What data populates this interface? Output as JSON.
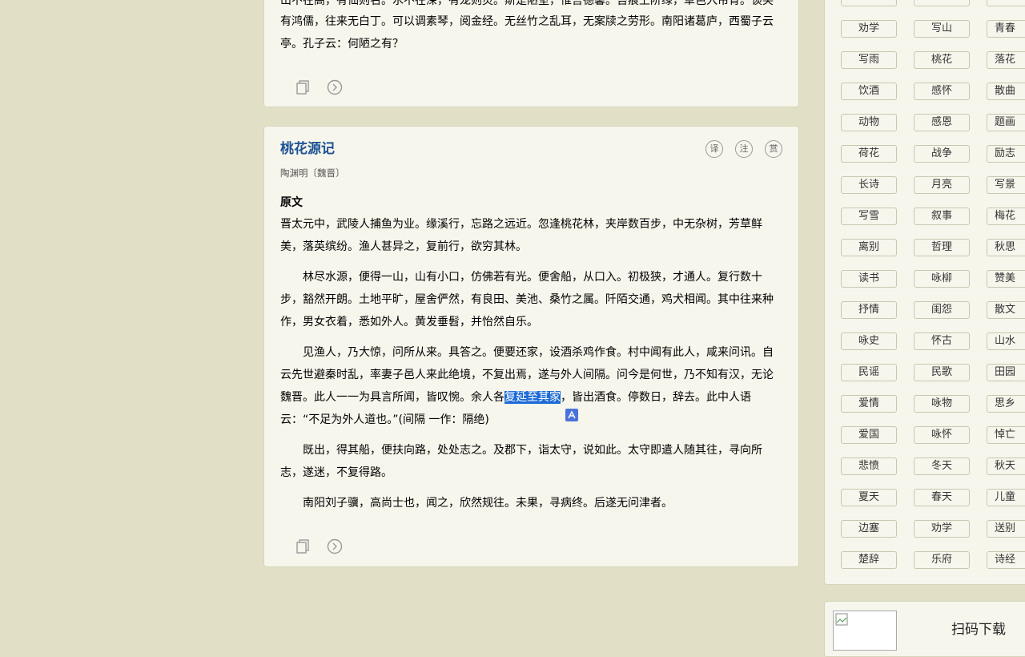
{
  "card1": {
    "top_partial": "山不在高，有仙则名。水不在深，有龙则灵。斯是陋室，惟吾德馨。苔痕上阶绿，草色入帘青。谈笑",
    "lines": [
      "有鸿儒，往来无白丁。可以调素琴，阅金经。无丝竹之乱耳，无案牍之劳形。南阳诸葛庐，西蜀子云",
      "亭。孔子云：何陋之有？"
    ]
  },
  "card2": {
    "title": "桃花源记",
    "author": "陶渊明〔魏晋〕",
    "buttons": {
      "translate": "译",
      "annotate": "注",
      "appreciate": "赏"
    },
    "section_label": "原文",
    "paragraphs": {
      "p1": "晋太元中，武陵人捕鱼为业。缘溪行，忘路之远近。忽逢桃花林，夹岸数百步，中无杂树，芳草鲜美，落英缤纷。渔人甚异之，复前行，欲穷其林。",
      "p2": "林尽水源，便得一山，山有小口，仿佛若有光。便舍船，从口入。初极狭，才通人。复行数十步，豁然开朗。土地平旷，屋舍俨然，有良田、美池、桑竹之属。阡陌交通，鸡犬相闻。其中往来种作，男女衣着，悉如外人。黄发垂髫，并怡然自乐。",
      "p3_before": "见渔人，乃大惊，问所从来。具答之。便要还家，设酒杀鸡作食。村中闻有此人，咸来问讯。自云先世避秦时乱，率妻子邑人来此绝境，不复出焉，遂与外人间隔。问今是何世，乃不知有汉，无论魏晋。此人一一为具言所闻，皆叹惋。余人各",
      "p3_highlight": "复延至其家",
      "p3_after": "，皆出酒食。停数日，辞去。此中人语云：“不足为外人道也。”(间隔 一作：隔绝)",
      "p4": "既出，得其船，便扶向路，处处志之。及郡下，诣太守，说如此。太守即遣人随其往，寻向所志，遂迷，不复得路。",
      "p5": "南阳刘子骥，高尚士也，闻之，欣然规往。未果，寻病终。后遂无问津者。"
    }
  },
  "tags": {
    "col1": [
      "劝学",
      "写雨",
      "饮酒",
      "动物",
      "荷花",
      "长诗",
      "写雪",
      "离别",
      "读书",
      "抒情",
      "咏史",
      "民谣",
      "爱情",
      "爱国",
      "悲愤",
      "夏天",
      "边塞",
      "楚辞"
    ],
    "col2": [
      "写山",
      "桃花",
      "感怀",
      "感恩",
      "战争",
      "月亮",
      "叙事",
      "哲理",
      "咏柳",
      "闺怨",
      "怀古",
      "民歌",
      "咏物",
      "咏怀",
      "冬天",
      "春天",
      "劝学",
      "乐府"
    ],
    "col3": [
      "青春",
      "落花",
      "散曲",
      "题画",
      "励志",
      "写景",
      "梅花",
      "秋思",
      "赞美",
      "散文",
      "山水",
      "田园",
      "思乡",
      "悼亡",
      "秋天",
      "儿童",
      "送别",
      "诗经"
    ]
  },
  "qr": {
    "label": "扫码下载"
  },
  "colors": {
    "background": "#e1e0c7",
    "card": "#f7f6ec",
    "title": "#1e5394",
    "highlight": "#1e6bd8"
  }
}
